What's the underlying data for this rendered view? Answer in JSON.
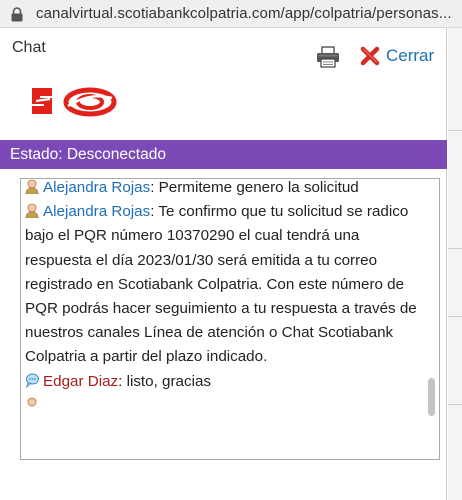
{
  "browser": {
    "url": "canalvirtual.scotiabankcolpatria.com/app/colpatria/personas..."
  },
  "chat": {
    "title": "Chat",
    "close_label": "Cerrar",
    "status": "Estado: Desconectado",
    "colors": {
      "status_bar": "#7b4ab7",
      "agent_name": "#1f6fb5",
      "user_name": "#a51c1c",
      "brand_red": "#e3211b"
    }
  },
  "messages": [
    {
      "sender": "Alejandra Rojas",
      "separator": ": ",
      "text": "Permiteme genero la solicitud",
      "role": "agent",
      "icon": "agent-avatar-icon"
    },
    {
      "sender": "Alejandra Rojas",
      "separator": ": ",
      "text": "Te confirmo que tu solicitud se radico bajo el PQR número 10370290 el cual tendrá una respuesta el día 2023/01/30   será emitida a tu correo registrado en Scotiabank Colpatria. Con este número de PQR podrás hacer seguimiento a tu respuesta a través de nuestros canales Línea de atención o Chat Scotiabank Colpatria a partir del plazo indicado.",
      "role": "agent",
      "icon": "agent-avatar-icon"
    },
    {
      "sender": "Edgar Diaz",
      "separator": ": ",
      "text": "listo, gracias",
      "role": "user",
      "icon": "user-bubble-icon"
    }
  ]
}
